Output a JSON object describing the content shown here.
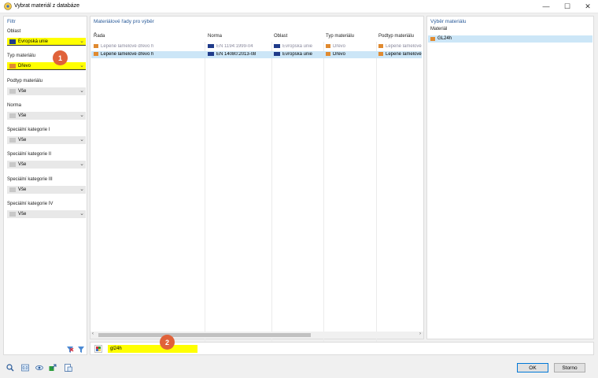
{
  "window": {
    "title": "Vybrat materiál z databáze",
    "minimize": "—",
    "maximize": "☐",
    "close": "✕"
  },
  "filter": {
    "title": "Filtr",
    "fields": [
      {
        "label": "Oblast",
        "value": "Evropská unie",
        "highlight": true,
        "swatch": "#1f3b8a"
      },
      {
        "label": "Typ materiálu",
        "value": "Dřevo",
        "highlight": true,
        "swatch": "#e08a30"
      },
      {
        "label": "Podtyp materiálu",
        "value": "Vše",
        "highlight": false,
        "swatch": "#c8c8c8"
      },
      {
        "label": "Norma",
        "value": "Vše",
        "highlight": false,
        "swatch": "#c8c8c8"
      },
      {
        "label": "Speciální kategorie I",
        "value": "Vše",
        "highlight": false,
        "swatch": "#c8c8c8"
      },
      {
        "label": "Speciální kategorie II",
        "value": "Vše",
        "highlight": false,
        "swatch": "#c8c8c8"
      },
      {
        "label": "Speciální kategorie III",
        "value": "Vše",
        "highlight": false,
        "swatch": "#c8c8c8"
      },
      {
        "label": "Speciální kategorie IV",
        "value": "Vše",
        "highlight": false,
        "swatch": "#c8c8c8"
      }
    ]
  },
  "series": {
    "title": "Materiálové řady pro výběr",
    "columns": [
      "Řada",
      "Norma",
      "Oblast",
      "Typ materiálu",
      "Podtyp materiálu"
    ],
    "rows": [
      {
        "rada": "Lepené lamelové dřevo h",
        "norma": "EN 1194:1999-04",
        "oblast": "Evropská unie",
        "typ": "Dřevo",
        "podtyp": "Lepené lamelové",
        "selected": false,
        "dim": true
      },
      {
        "rada": "Lepené lamelové dřevo h",
        "norma": "EN 14080:2013-08",
        "oblast": "Evropská unie",
        "typ": "Dřevo",
        "podtyp": "Lepené lamelové",
        "selected": true,
        "dim": false
      }
    ],
    "search_value": "gl24h"
  },
  "selection": {
    "title": "Výběr materiálu",
    "column": "Materiál",
    "items": [
      {
        "label": "GL24h",
        "selected": true
      }
    ]
  },
  "buttons": {
    "ok": "OK",
    "cancel": "Storno"
  },
  "badges": {
    "one": "1",
    "two": "2"
  },
  "colors": {
    "accent": "#2a5b9a",
    "highlight": "#ffff00",
    "badge": "#e0623a",
    "wood": "#e08a30",
    "selected_row": "#cce6f7"
  }
}
